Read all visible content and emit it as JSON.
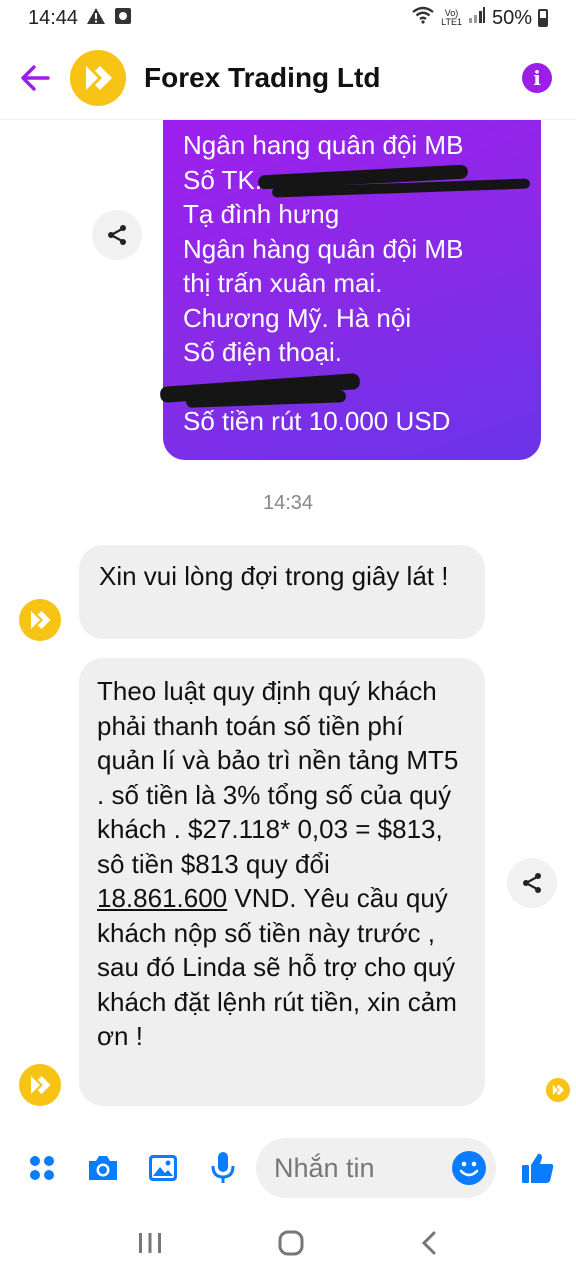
{
  "status_bar": {
    "time": "14:44",
    "battery": "50%",
    "volte": "Vo)\nLTE1"
  },
  "header": {
    "title": "Forex Trading Ltd"
  },
  "purple_message": {
    "lines": [
      "Ngân hang quân đội MB",
      "Số TK.",
      "Tạ đình hưng",
      "Ngân hàng quân đội MB",
      "thị trấn xuân mai.",
      "Chương Mỹ. Hà nội",
      "Số điện thoại.",
      "",
      "Số tiền rút 10.000 USD"
    ]
  },
  "timestamp": "14:34",
  "messages": [
    {
      "text": "Xin vui lòng đợi trong giây lát !"
    },
    {
      "text_before": "Theo luật quy định quý khách phải thanh toán số tiền phí quản lí và bảo trì nền tảng MT5 . số tiền là 3% tổng số  của quý khách . $27.118* 0,03 = $813, sô tiền $813 quy đổi ",
      "text_underlined": "18.861.600",
      "text_after": " VND. Yêu cầu quý khách nộp số tiền này trước , sau đó Linda sẽ hỗ trợ cho quý khách đặt lệnh rút tiền, xin cảm ơn !"
    }
  ],
  "composer": {
    "placeholder": "Nhắn tin"
  },
  "colors": {
    "accent": "#0a7cff",
    "purple": "#9b1fe8",
    "logo_yellow": "#f7c315"
  }
}
